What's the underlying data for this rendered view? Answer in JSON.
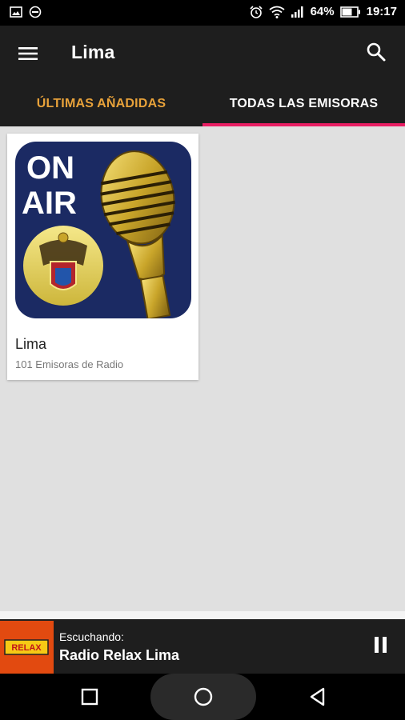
{
  "status_bar": {
    "battery": "64%",
    "time": "19:17",
    "icons": [
      "image-icon",
      "no-entry-icon",
      "alarm-icon",
      "wifi-icon",
      "signal-icon",
      "battery-icon"
    ]
  },
  "app_bar": {
    "title": "Lima",
    "menu_icon": "hamburger-menu-icon",
    "search_icon": "search-icon"
  },
  "tabs": [
    {
      "label": "ÚLTIMAS AÑADIDAS",
      "color": "#e8a23a",
      "selected": false
    },
    {
      "label": "TODAS LAS EMISORAS",
      "color": "#ffffff",
      "selected": true
    }
  ],
  "accent": {
    "indicator": "#e91e63"
  },
  "cards": [
    {
      "title": "Lima",
      "subtitle": "101 Emisoras de Radio",
      "artwork": {
        "line1": "ON",
        "line2": "AIR"
      }
    }
  ],
  "now_playing": {
    "label": "Escuchando:",
    "station": "Radio Relax Lima",
    "thumb_text": "RELAX",
    "control_icon": "pause-icon"
  },
  "nav_bar": {
    "icons": [
      "recents-icon",
      "home-icon",
      "back-icon"
    ]
  }
}
